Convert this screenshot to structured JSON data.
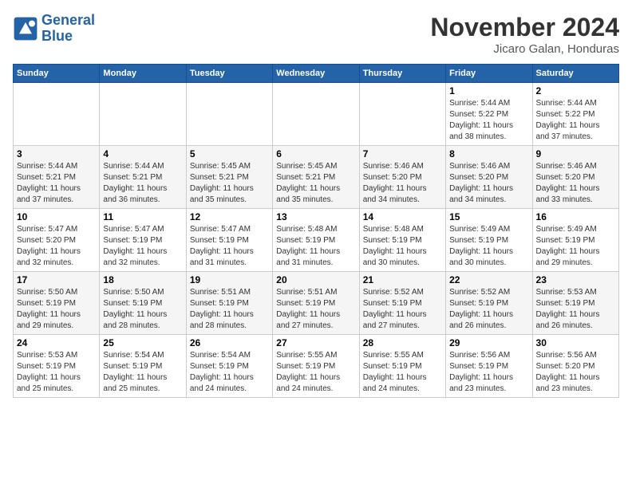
{
  "header": {
    "logo_line1": "General",
    "logo_line2": "Blue",
    "month": "November 2024",
    "location": "Jicaro Galan, Honduras"
  },
  "weekdays": [
    "Sunday",
    "Monday",
    "Tuesday",
    "Wednesday",
    "Thursday",
    "Friday",
    "Saturday"
  ],
  "weeks": [
    [
      {
        "day": "",
        "info": ""
      },
      {
        "day": "",
        "info": ""
      },
      {
        "day": "",
        "info": ""
      },
      {
        "day": "",
        "info": ""
      },
      {
        "day": "",
        "info": ""
      },
      {
        "day": "1",
        "info": "Sunrise: 5:44 AM\nSunset: 5:22 PM\nDaylight: 11 hours\nand 38 minutes."
      },
      {
        "day": "2",
        "info": "Sunrise: 5:44 AM\nSunset: 5:22 PM\nDaylight: 11 hours\nand 37 minutes."
      }
    ],
    [
      {
        "day": "3",
        "info": "Sunrise: 5:44 AM\nSunset: 5:21 PM\nDaylight: 11 hours\nand 37 minutes."
      },
      {
        "day": "4",
        "info": "Sunrise: 5:44 AM\nSunset: 5:21 PM\nDaylight: 11 hours\nand 36 minutes."
      },
      {
        "day": "5",
        "info": "Sunrise: 5:45 AM\nSunset: 5:21 PM\nDaylight: 11 hours\nand 35 minutes."
      },
      {
        "day": "6",
        "info": "Sunrise: 5:45 AM\nSunset: 5:21 PM\nDaylight: 11 hours\nand 35 minutes."
      },
      {
        "day": "7",
        "info": "Sunrise: 5:46 AM\nSunset: 5:20 PM\nDaylight: 11 hours\nand 34 minutes."
      },
      {
        "day": "8",
        "info": "Sunrise: 5:46 AM\nSunset: 5:20 PM\nDaylight: 11 hours\nand 34 minutes."
      },
      {
        "day": "9",
        "info": "Sunrise: 5:46 AM\nSunset: 5:20 PM\nDaylight: 11 hours\nand 33 minutes."
      }
    ],
    [
      {
        "day": "10",
        "info": "Sunrise: 5:47 AM\nSunset: 5:20 PM\nDaylight: 11 hours\nand 32 minutes."
      },
      {
        "day": "11",
        "info": "Sunrise: 5:47 AM\nSunset: 5:19 PM\nDaylight: 11 hours\nand 32 minutes."
      },
      {
        "day": "12",
        "info": "Sunrise: 5:47 AM\nSunset: 5:19 PM\nDaylight: 11 hours\nand 31 minutes."
      },
      {
        "day": "13",
        "info": "Sunrise: 5:48 AM\nSunset: 5:19 PM\nDaylight: 11 hours\nand 31 minutes."
      },
      {
        "day": "14",
        "info": "Sunrise: 5:48 AM\nSunset: 5:19 PM\nDaylight: 11 hours\nand 30 minutes."
      },
      {
        "day": "15",
        "info": "Sunrise: 5:49 AM\nSunset: 5:19 PM\nDaylight: 11 hours\nand 30 minutes."
      },
      {
        "day": "16",
        "info": "Sunrise: 5:49 AM\nSunset: 5:19 PM\nDaylight: 11 hours\nand 29 minutes."
      }
    ],
    [
      {
        "day": "17",
        "info": "Sunrise: 5:50 AM\nSunset: 5:19 PM\nDaylight: 11 hours\nand 29 minutes."
      },
      {
        "day": "18",
        "info": "Sunrise: 5:50 AM\nSunset: 5:19 PM\nDaylight: 11 hours\nand 28 minutes."
      },
      {
        "day": "19",
        "info": "Sunrise: 5:51 AM\nSunset: 5:19 PM\nDaylight: 11 hours\nand 28 minutes."
      },
      {
        "day": "20",
        "info": "Sunrise: 5:51 AM\nSunset: 5:19 PM\nDaylight: 11 hours\nand 27 minutes."
      },
      {
        "day": "21",
        "info": "Sunrise: 5:52 AM\nSunset: 5:19 PM\nDaylight: 11 hours\nand 27 minutes."
      },
      {
        "day": "22",
        "info": "Sunrise: 5:52 AM\nSunset: 5:19 PM\nDaylight: 11 hours\nand 26 minutes."
      },
      {
        "day": "23",
        "info": "Sunrise: 5:53 AM\nSunset: 5:19 PM\nDaylight: 11 hours\nand 26 minutes."
      }
    ],
    [
      {
        "day": "24",
        "info": "Sunrise: 5:53 AM\nSunset: 5:19 PM\nDaylight: 11 hours\nand 25 minutes."
      },
      {
        "day": "25",
        "info": "Sunrise: 5:54 AM\nSunset: 5:19 PM\nDaylight: 11 hours\nand 25 minutes."
      },
      {
        "day": "26",
        "info": "Sunrise: 5:54 AM\nSunset: 5:19 PM\nDaylight: 11 hours\nand 24 minutes."
      },
      {
        "day": "27",
        "info": "Sunrise: 5:55 AM\nSunset: 5:19 PM\nDaylight: 11 hours\nand 24 minutes."
      },
      {
        "day": "28",
        "info": "Sunrise: 5:55 AM\nSunset: 5:19 PM\nDaylight: 11 hours\nand 24 minutes."
      },
      {
        "day": "29",
        "info": "Sunrise: 5:56 AM\nSunset: 5:19 PM\nDaylight: 11 hours\nand 23 minutes."
      },
      {
        "day": "30",
        "info": "Sunrise: 5:56 AM\nSunset: 5:20 PM\nDaylight: 11 hours\nand 23 minutes."
      }
    ]
  ]
}
